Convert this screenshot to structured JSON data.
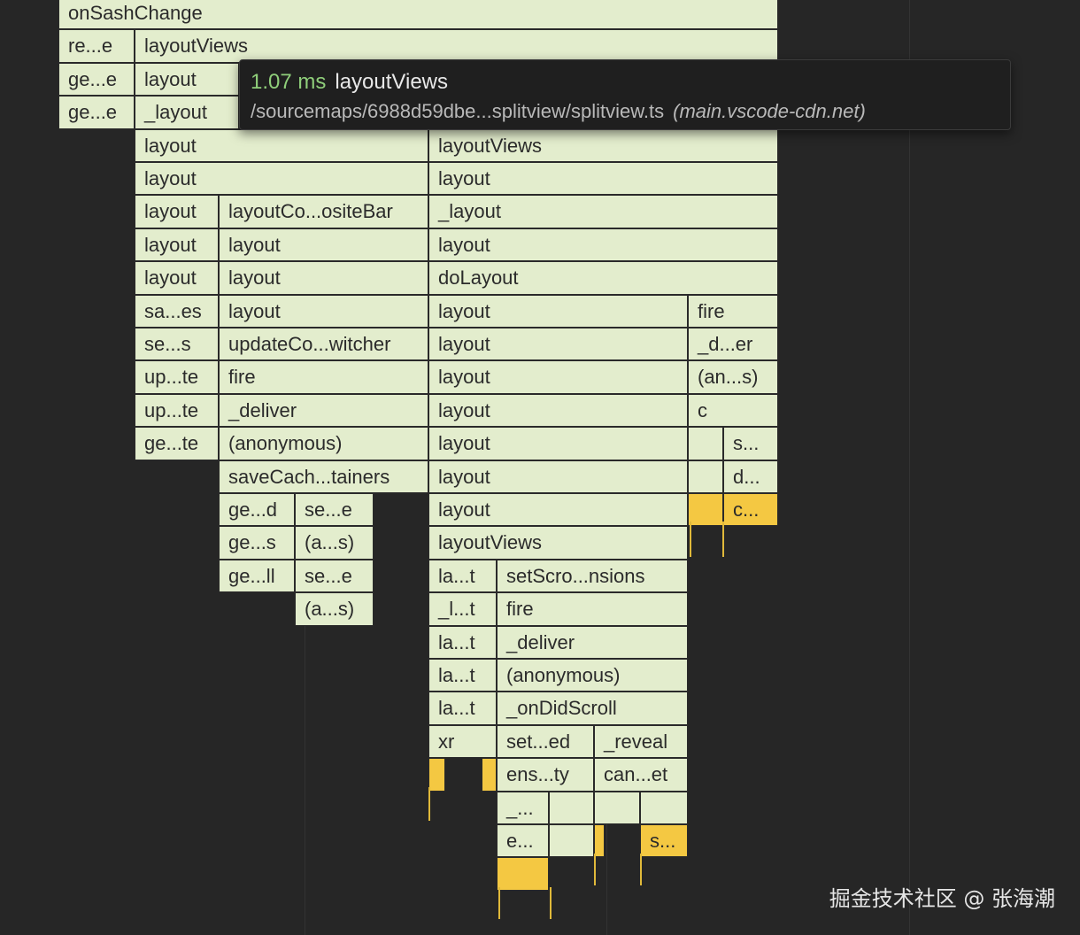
{
  "tooltip": {
    "duration": "1.07 ms",
    "function_name": "layoutViews",
    "source_path": "/sourcemaps/6988d59dbe...splitview/splitview.ts",
    "host": "(main.vscode-cdn.net)"
  },
  "frames": [
    {
      "label": "onSashChange"
    },
    {
      "label": "re...e"
    },
    {
      "label": "layoutViews"
    },
    {
      "label": "ge...e"
    },
    {
      "label": "layout"
    },
    {
      "label": "ge...e"
    },
    {
      "label": "_layout"
    },
    {
      "label": "layout"
    },
    {
      "label": "layoutViews"
    },
    {
      "label": "layout"
    },
    {
      "label": "layout"
    },
    {
      "label": "layout"
    },
    {
      "label": "layoutCo...ositeBar"
    },
    {
      "label": "_layout"
    },
    {
      "label": "layout"
    },
    {
      "label": "layout"
    },
    {
      "label": "layout"
    },
    {
      "label": "layout"
    },
    {
      "label": "layout"
    },
    {
      "label": "doLayout"
    },
    {
      "label": "sa...es"
    },
    {
      "label": "layout"
    },
    {
      "label": "layout"
    },
    {
      "label": "fire"
    },
    {
      "label": "se...s"
    },
    {
      "label": "updateCo...witcher"
    },
    {
      "label": "layout"
    },
    {
      "label": "_d...er"
    },
    {
      "label": "up...te"
    },
    {
      "label": "fire"
    },
    {
      "label": "layout"
    },
    {
      "label": "(an...s)"
    },
    {
      "label": "up...te"
    },
    {
      "label": "_deliver"
    },
    {
      "label": "layout"
    },
    {
      "label": "c"
    },
    {
      "label": "ge...te"
    },
    {
      "label": "(anonymous)"
    },
    {
      "label": "layout"
    },
    {
      "label": ""
    },
    {
      "label": "s..."
    },
    {
      "label": "saveCach...tainers"
    },
    {
      "label": "layout"
    },
    {
      "label": ""
    },
    {
      "label": "d..."
    },
    {
      "label": "ge...d"
    },
    {
      "label": "se...e"
    },
    {
      "label": "layout"
    },
    {
      "label": "",
      "hot": true
    },
    {
      "label": "c...",
      "hot": true
    },
    {
      "label": "ge...s"
    },
    {
      "label": "(a...s)"
    },
    {
      "label": "layoutViews"
    },
    {
      "label": "ge...ll"
    },
    {
      "label": "se...e"
    },
    {
      "label": "la...t"
    },
    {
      "label": "setScro...nsions"
    },
    {
      "label": "(a...s)"
    },
    {
      "label": "_l...t"
    },
    {
      "label": "fire"
    },
    {
      "label": "la...t"
    },
    {
      "label": "_deliver"
    },
    {
      "label": "la...t"
    },
    {
      "label": "(anonymous)"
    },
    {
      "label": "la...t"
    },
    {
      "label": "_onDidScroll"
    },
    {
      "label": "xr"
    },
    {
      "label": "set...ed"
    },
    {
      "label": "_reveal"
    },
    {
      "label": "",
      "hot": true
    },
    {
      "label": "",
      "hot": true
    },
    {
      "label": "ens...ty"
    },
    {
      "label": "can...et"
    },
    {
      "label": "_..."
    },
    {
      "label": ""
    },
    {
      "label": ""
    },
    {
      "label": ""
    },
    {
      "label": "e..."
    },
    {
      "label": ""
    },
    {
      "label": "",
      "hot": true
    },
    {
      "label": "s...",
      "hot": true
    },
    {
      "label": "",
      "hot": true
    }
  ],
  "watermark": "掘金技术社区 @ 张海潮"
}
